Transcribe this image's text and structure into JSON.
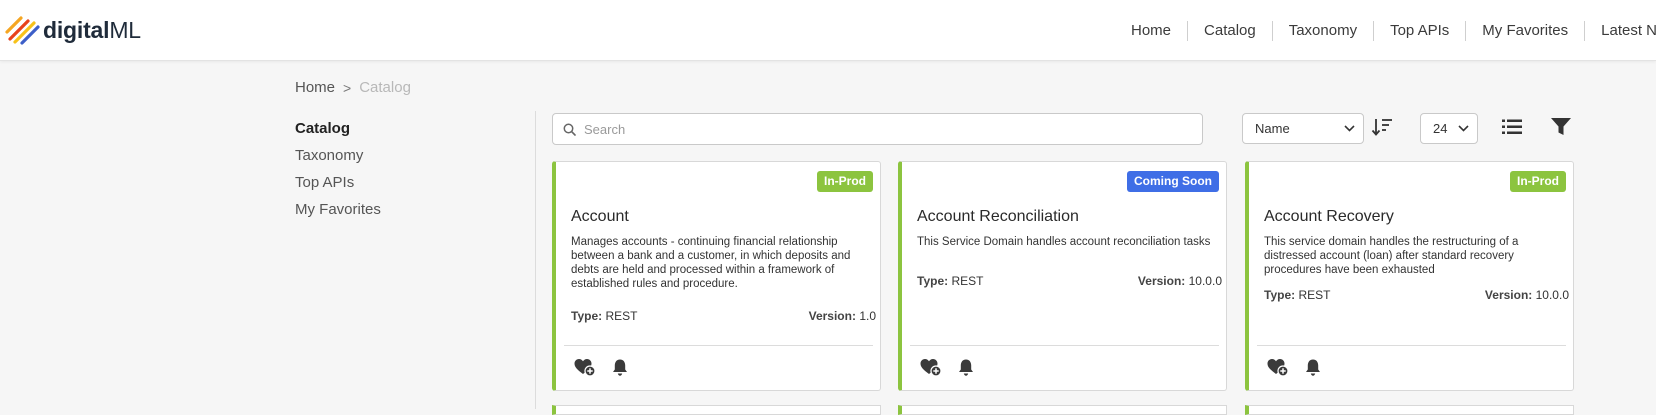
{
  "brand": {
    "name_strong": "digital",
    "name_rest": "ML",
    "mark_colors": [
      "#f5a623",
      "#e8421b",
      "#f7c21a",
      "#3d5fc8"
    ]
  },
  "topnav": {
    "items": [
      "Home",
      "Catalog",
      "Taxonomy",
      "Top APIs",
      "My Favorites",
      "Latest N"
    ]
  },
  "breadcrumb": {
    "home": "Home",
    "separator": ">",
    "current": "Catalog"
  },
  "sidebar": {
    "items": [
      {
        "label": "Catalog",
        "active": true
      },
      {
        "label": "Taxonomy",
        "active": false
      },
      {
        "label": "Top APIs",
        "active": false
      },
      {
        "label": "My Favorites",
        "active": false
      }
    ]
  },
  "toolbar": {
    "search_placeholder": "Search",
    "search_value": "",
    "sort_value": "Name",
    "page_size_value": "24",
    "icons": [
      "search-icon",
      "sort-descending-icon",
      "list-view-icon",
      "filter-icon",
      "chevron-down-icon"
    ]
  },
  "cards": [
    {
      "badge": "In-Prod",
      "badge_color": "#8cc43f",
      "title": "Account",
      "description": "Manages accounts - continuing financial relationship between a bank and a customer, in which deposits and debts are held and processed within a framework of established rules and procedure.",
      "type_label": "Type:",
      "type_value": "REST",
      "version_label": "Version:",
      "version_value": "1.0"
    },
    {
      "badge": "Coming Soon",
      "badge_color": "#3f6ee6",
      "title": "Account Reconciliation",
      "description": "This Service Domain handles account reconciliation tasks",
      "type_label": "Type:",
      "type_value": "REST",
      "version_label": "Version:",
      "version_value": "10.0.0"
    },
    {
      "badge": "In-Prod",
      "badge_color": "#8cc43f",
      "title": "Account Recovery",
      "description": "This service domain handles the restructuring of a distressed account (loan) after standard recovery procedures have been exhausted",
      "type_label": "Type:",
      "type_value": "REST",
      "version_label": "Version:",
      "version_value": "10.0.0"
    }
  ],
  "accent_color": "#8cc43f"
}
